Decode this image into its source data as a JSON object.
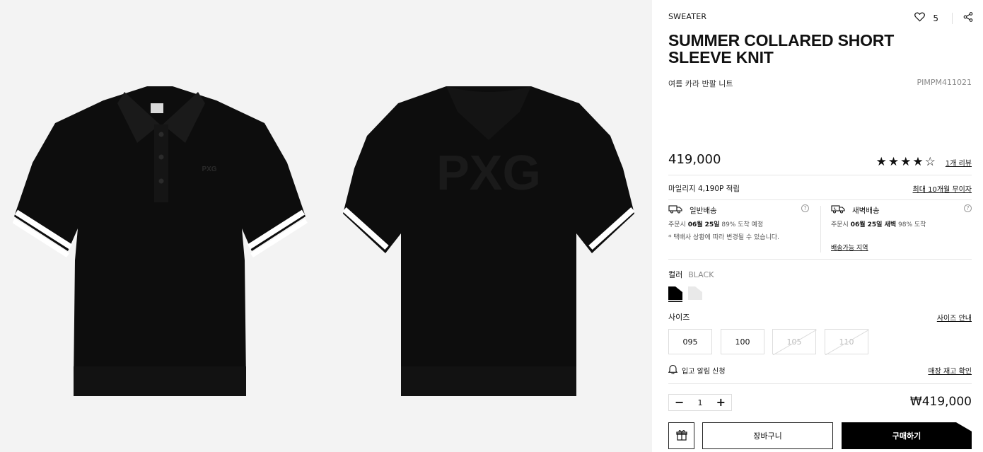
{
  "colors": {
    "garment": "#0d0d0d",
    "stripe_white": "#ffffff",
    "accent": "#000000"
  },
  "gallery": {
    "images": [
      {
        "view": "front",
        "logo_text": "PXG"
      },
      {
        "view": "back",
        "logo_text": "PXG"
      }
    ]
  },
  "product": {
    "category": "SWEATER",
    "wishlist_icon": "heart-icon",
    "wishlist_count": "5",
    "share_icon": "share-icon",
    "title": "SUMMER COLLARED SHORT SLEEVE KNIT",
    "subtitle_ko": "여름 카라 반팔 니트",
    "code": "PIMPM411021",
    "price": "419,000",
    "stars": "★★★★☆",
    "rating_value": 4,
    "rating_max": 5,
    "review_link": "1개 리뷰"
  },
  "benefits": {
    "mileage": "마일리지 4,190P 적립",
    "installment_link": "최대 10개월 무이자"
  },
  "shipping": {
    "standard": {
      "icon": "truck-icon",
      "title": "일반배송",
      "line1_pre": "주문시",
      "line1_date": "06월 25일",
      "line1_post": "89% 도착 예정",
      "line2": "* 택배사 상황에 따라 변경될 수 있습니다."
    },
    "dawn": {
      "icon": "moon-truck-icon",
      "title": "새벽배송",
      "line1_pre": "주문시",
      "line1_date": "06월 25일 새벽",
      "line1_post": "98% 도착",
      "area_link": "배송가능 지역"
    },
    "help_symbol": "?"
  },
  "options": {
    "color_label": "컬러",
    "color_selected": "BLACK",
    "colors": [
      {
        "name": "black",
        "hex": "#000000",
        "selected": true
      },
      {
        "name": "white",
        "hex": "#e9e9e9",
        "selected": false
      }
    ],
    "size_label": "사이즈",
    "size_guide_link": "사이즈 안내",
    "sizes": [
      {
        "label": "095",
        "available": true
      },
      {
        "label": "100",
        "available": true
      },
      {
        "label": "105",
        "available": false
      },
      {
        "label": "110",
        "available": false
      }
    ],
    "restock_icon": "bell-icon",
    "restock_label": "입고 알림 신청",
    "store_stock_link": "매장 재고 확인"
  },
  "purchase": {
    "minus": "−",
    "quantity": "1",
    "plus": "+",
    "total": "₩419,000",
    "gift_icon": "gift-icon",
    "cart_label": "장바구니",
    "buy_label": "구매하기"
  }
}
